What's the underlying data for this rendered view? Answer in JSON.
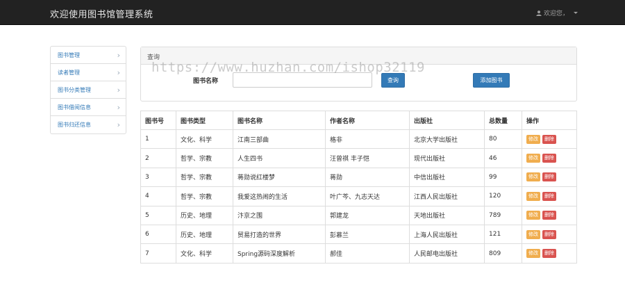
{
  "navbar": {
    "title": "欢迎使用图书馆管理系统",
    "user_label": "欢迎您，"
  },
  "sidebar": {
    "items": [
      {
        "label": "图书管理"
      },
      {
        "label": "读者管理"
      },
      {
        "label": "图书分类管理"
      },
      {
        "label": "图书借阅信息"
      },
      {
        "label": "图书归还信息"
      }
    ]
  },
  "query_panel": {
    "heading": "查询",
    "book_name_label": "图书名称",
    "book_name_value": "",
    "query_button": "查询",
    "add_button": "添加图书"
  },
  "watermark": "https://www.huzhan.com/ishop32119",
  "table": {
    "headers": [
      "图书号",
      "图书类型",
      "图书名称",
      "作者名称",
      "出版社",
      "总数量",
      "操作"
    ],
    "edit_label": "修改",
    "delete_label": "删除",
    "rows": [
      {
        "id": "1",
        "type": "文化、科学",
        "name": "江南三部曲",
        "author": "格非",
        "publisher": "北京大学出版社",
        "count": "80"
      },
      {
        "id": "2",
        "type": "哲学、宗教",
        "name": "人生四书",
        "author": "汪曾祺 丰子恺",
        "publisher": "现代出版社",
        "count": "46"
      },
      {
        "id": "3",
        "type": "哲学、宗教",
        "name": "蒋勋说红楼梦",
        "author": "蒋勋",
        "publisher": "中信出版社",
        "count": "99"
      },
      {
        "id": "4",
        "type": "哲学、宗教",
        "name": "我爱这热闹的生活",
        "author": "叶广芩、九志天达",
        "publisher": "江西人民出版社",
        "count": "120"
      },
      {
        "id": "5",
        "type": "历史、地理",
        "name": "汴京之围",
        "author": "郭建龙",
        "publisher": "天地出版社",
        "count": "789"
      },
      {
        "id": "6",
        "type": "历史、地理",
        "name": "贸易打造的世界",
        "author": "彭慕兰",
        "publisher": "上海人民出版社",
        "count": "121"
      },
      {
        "id": "7",
        "type": "文化、科学",
        "name": "Spring源码深度解析",
        "author": "郝佳",
        "publisher": "人民邮电出版社",
        "count": "809"
      }
    ]
  },
  "colors": {
    "navbar_bg": "#222222",
    "primary": "#337ab7",
    "warning": "#f0ad4e",
    "danger": "#d9534f"
  }
}
